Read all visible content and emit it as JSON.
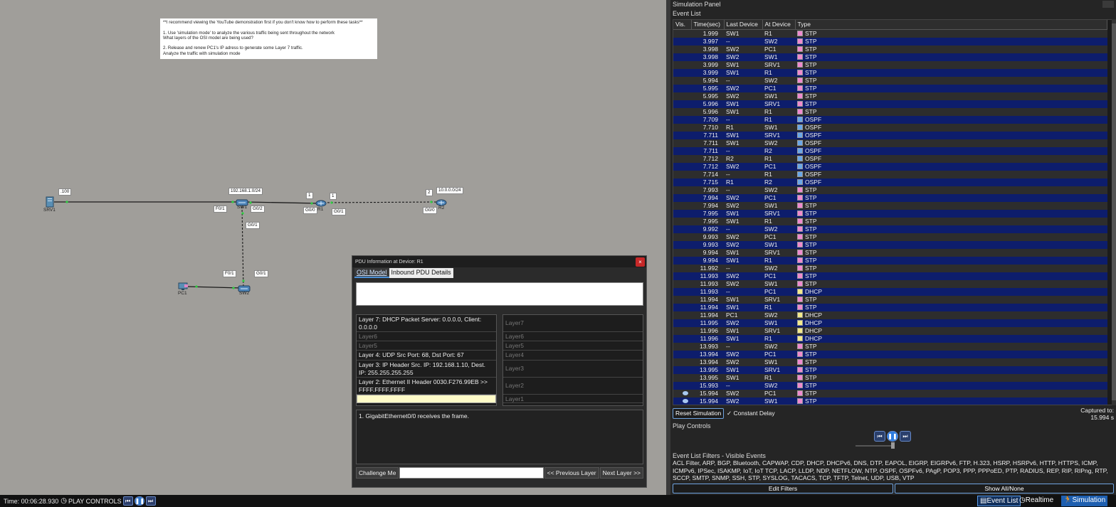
{
  "workspace": {
    "note": "**I recommend viewing the YouTube demonstration first if you don't know how to perform these tasks**\n\n1. Use 'simulation mode' to analyze the various traffic being sent throughout the network\n    What layers of the OSI model are being used?\n\n2. Release and renew PC1's IP adress to generate some Layer 7 traffic.\n    Analyze the traffic with simulation mode",
    "devices": {
      "srv1": "SRV1",
      "sw1": "SW1",
      "r1": "R1",
      "r2": "R2",
      "pc1": "PC1",
      "sw2": "SW2"
    },
    "tags": {
      "srv1_ip": ".100",
      "lan_net": "192.168.1.0/24",
      "r1_left": "1",
      "r1_right": "1",
      "r2_ip": "2",
      "wan_net": "10.0.0.0/24",
      "sw1_f0_1": "F0/1",
      "sw1_g0_2": "G0/2",
      "r1_g0_0": "G0/0",
      "r1_g0_1": "G0/1",
      "r2_g0_0": "G0/0",
      "sw1_g0_1": "G0/1",
      "pc1_f0_1": "F0/1",
      "sw2_g0_1": "G0/1"
    }
  },
  "pdu": {
    "title": "PDU Information at Device: R1",
    "close_label": "×",
    "tab_osi": "OSI Model",
    "tab_inbound": "Inbound PDU Details",
    "in_layers": [
      "Layer 7: DHCP Packet Server: 0.0.0.0, Client: 0.0.0.0",
      "Layer6",
      "Layer5",
      "Layer 4: UDP Src Port: 68, Dst Port: 67",
      "Layer 3: IP Header Src. IP: 192.168.1.10, Dest. IP: 255.255.255.255",
      "Layer 2: Ethernet II Header 0030.F276.99EB >> FFFF.FFFF.FFFF",
      ""
    ],
    "out_layers": [
      "Layer7",
      "Layer6",
      "Layer5",
      "Layer4",
      "Layer3",
      "Layer2",
      "Layer1"
    ],
    "description": "1. GigabitEthernet0/0 receives the frame.",
    "challenge_label": "Challenge Me",
    "prev_label": "<< Previous Layer",
    "next_label": "Next Layer >>"
  },
  "bottombar": {
    "time": "Time: 00:06:28.930",
    "play_controls": "PLAY CONTROLS",
    "event_list_btn": "Event List",
    "realtime_btn": "Realtime",
    "simulation_btn": "Simulation"
  },
  "sim": {
    "title": "Simulation Panel",
    "event_list_label": "Event List",
    "columns": [
      "Vis.",
      "Time(sec)",
      "Last Device",
      "At Device",
      "Type"
    ],
    "events": [
      [
        "",
        "1.999",
        "SW1",
        "R1",
        "STP"
      ],
      [
        "",
        "3.997",
        "--",
        "SW2",
        "STP"
      ],
      [
        "",
        "3.998",
        "SW2",
        "PC1",
        "STP"
      ],
      [
        "",
        "3.998",
        "SW2",
        "SW1",
        "STP"
      ],
      [
        "",
        "3.999",
        "SW1",
        "SRV1",
        "STP"
      ],
      [
        "",
        "3.999",
        "SW1",
        "R1",
        "STP"
      ],
      [
        "",
        "5.994",
        "--",
        "SW2",
        "STP"
      ],
      [
        "",
        "5.995",
        "SW2",
        "PC1",
        "STP"
      ],
      [
        "",
        "5.995",
        "SW2",
        "SW1",
        "STP"
      ],
      [
        "",
        "5.996",
        "SW1",
        "SRV1",
        "STP"
      ],
      [
        "",
        "5.996",
        "SW1",
        "R1",
        "STP"
      ],
      [
        "",
        "7.709",
        "--",
        "R1",
        "OSPF"
      ],
      [
        "",
        "7.710",
        "R1",
        "SW1",
        "OSPF"
      ],
      [
        "",
        "7.711",
        "SW1",
        "SRV1",
        "OSPF"
      ],
      [
        "",
        "7.711",
        "SW1",
        "SW2",
        "OSPF"
      ],
      [
        "",
        "7.711",
        "--",
        "R2",
        "OSPF"
      ],
      [
        "",
        "7.712",
        "R2",
        "R1",
        "OSPF"
      ],
      [
        "",
        "7.712",
        "SW2",
        "PC1",
        "OSPF"
      ],
      [
        "",
        "7.714",
        "--",
        "R1",
        "OSPF"
      ],
      [
        "",
        "7.715",
        "R1",
        "R2",
        "OSPF"
      ],
      [
        "",
        "7.993",
        "--",
        "SW2",
        "STP"
      ],
      [
        "",
        "7.994",
        "SW2",
        "PC1",
        "STP"
      ],
      [
        "",
        "7.994",
        "SW2",
        "SW1",
        "STP"
      ],
      [
        "",
        "7.995",
        "SW1",
        "SRV1",
        "STP"
      ],
      [
        "",
        "7.995",
        "SW1",
        "R1",
        "STP"
      ],
      [
        "",
        "9.992",
        "--",
        "SW2",
        "STP"
      ],
      [
        "",
        "9.993",
        "SW2",
        "PC1",
        "STP"
      ],
      [
        "",
        "9.993",
        "SW2",
        "SW1",
        "STP"
      ],
      [
        "",
        "9.994",
        "SW1",
        "SRV1",
        "STP"
      ],
      [
        "",
        "9.994",
        "SW1",
        "R1",
        "STP"
      ],
      [
        "",
        "11.992",
        "--",
        "SW2",
        "STP"
      ],
      [
        "",
        "11.993",
        "SW2",
        "PC1",
        "STP"
      ],
      [
        "",
        "11.993",
        "SW2",
        "SW1",
        "STP"
      ],
      [
        "",
        "11.993",
        "--",
        "PC1",
        "DHCP"
      ],
      [
        "",
        "11.994",
        "SW1",
        "SRV1",
        "STP"
      ],
      [
        "",
        "11.994",
        "SW1",
        "R1",
        "STP"
      ],
      [
        "",
        "11.994",
        "PC1",
        "SW2",
        "DHCP"
      ],
      [
        "",
        "11.995",
        "SW2",
        "SW1",
        "DHCP"
      ],
      [
        "",
        "11.996",
        "SW1",
        "SRV1",
        "DHCP"
      ],
      [
        "",
        "11.996",
        "SW1",
        "R1",
        "DHCP"
      ],
      [
        "",
        "13.993",
        "--",
        "SW2",
        "STP"
      ],
      [
        "",
        "13.994",
        "SW2",
        "PC1",
        "STP"
      ],
      [
        "",
        "13.994",
        "SW2",
        "SW1",
        "STP"
      ],
      [
        "",
        "13.995",
        "SW1",
        "SRV1",
        "STP"
      ],
      [
        "",
        "13.995",
        "SW1",
        "R1",
        "STP"
      ],
      [
        "",
        "15.993",
        "--",
        "SW2",
        "STP"
      ],
      [
        "eye",
        "15.994",
        "SW2",
        "PC1",
        "STP"
      ],
      [
        "eye",
        "15.994",
        "SW2",
        "SW1",
        "STP"
      ]
    ],
    "type_colors": {
      "STP": "#f08ad0",
      "OSPF": "#6aa7e8",
      "DHCP": "#f3ea8c"
    },
    "reset_label": "Reset Simulation",
    "constant_delay": "Constant Delay",
    "captured_line1": "Captured to:",
    "captured_line2": "15.994 s",
    "play_controls_label": "Play Controls",
    "filters_label": "Event List Filters - Visible Events",
    "filters_text": "ACL Filter, ARP, BGP, Bluetooth, CAPWAP, CDP, DHCP, DHCPv6, DNS, DTP, EAPOL, EIGRP, EIGRPv6, FTP, H.323, HSRP, HSRPv6, HTTP, HTTPS, ICMP, ICMPv6, IPSec, ISAKMP, IoT, IoT TCP, LACP, LLDP, NDP, NETFLOW, NTP, OSPF, OSPFv6, PAgP, POP3, PPP, PPPoED, PTP, RADIUS, REP, RIP, RIPng, RTP, SCCP, SMTP, SNMP, SSH, STP, SYSLOG, TACACS, TCP, TFTP, Telnet, UDP, USB, VTP",
    "edit_filters_label": "Edit Filters",
    "show_all_label": "Show All/None"
  }
}
